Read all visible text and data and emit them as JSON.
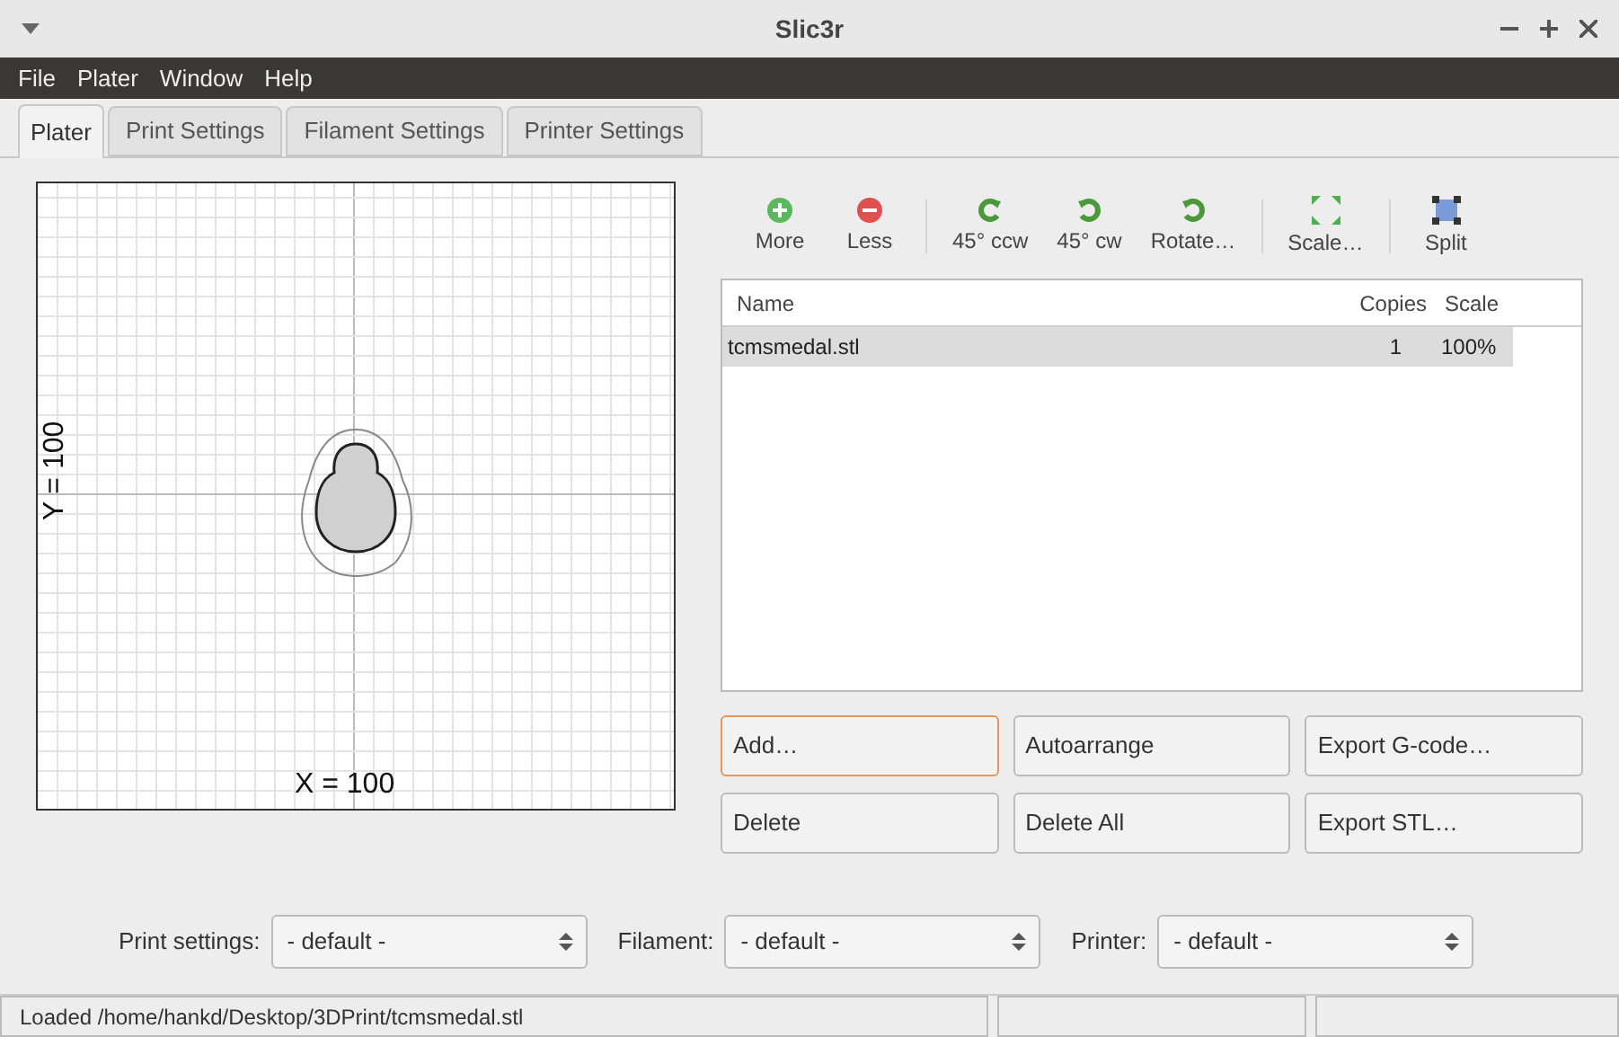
{
  "window": {
    "title": "Slic3r"
  },
  "menu": [
    "File",
    "Plater",
    "Window",
    "Help"
  ],
  "tabs": [
    {
      "label": "Plater",
      "selected": true
    },
    {
      "label": "Print Settings",
      "selected": false
    },
    {
      "label": "Filament Settings",
      "selected": false
    },
    {
      "label": "Printer Settings",
      "selected": false
    }
  ],
  "plate": {
    "x_label": "X = 100",
    "y_label": "Y = 100"
  },
  "toolbar": [
    {
      "label": "More",
      "kind": "add",
      "separator_before": false
    },
    {
      "label": "Less",
      "kind": "remove",
      "separator_before": false
    },
    {
      "label": "45° ccw",
      "kind": "ccw",
      "separator_before": true
    },
    {
      "label": "45° cw",
      "kind": "cw",
      "separator_before": false
    },
    {
      "label": "Rotate…",
      "kind": "cw",
      "separator_before": false
    },
    {
      "label": "Scale…",
      "kind": "scale",
      "separator_before": true
    },
    {
      "label": "Split",
      "kind": "split",
      "separator_before": true
    }
  ],
  "table": {
    "columns": [
      "Name",
      "Copies",
      "Scale"
    ],
    "rows": [
      {
        "name": "tcmsmedal.stl",
        "copies": "1",
        "scale": "100%",
        "selected": true
      }
    ]
  },
  "buttons": [
    {
      "label": "Add…",
      "focused": true
    },
    {
      "label": "Autoarrange",
      "focused": false
    },
    {
      "label": "Export G-code…",
      "focused": false
    },
    {
      "label": "Delete",
      "focused": false
    },
    {
      "label": "Delete All",
      "focused": false
    },
    {
      "label": "Export STL…",
      "focused": false
    }
  ],
  "selectors": [
    {
      "label": "Print settings:",
      "value": "- default -"
    },
    {
      "label": "Filament:",
      "value": "- default -"
    },
    {
      "label": "Printer:",
      "value": "- default -"
    }
  ],
  "status_bar": {
    "text": "Loaded /home/hankd/Desktop/3DPrint/tcmsmedal.stl"
  }
}
